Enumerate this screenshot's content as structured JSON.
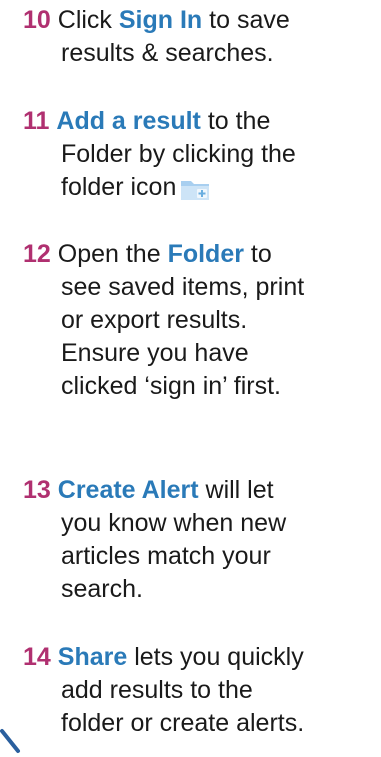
{
  "steps": [
    {
      "number": "10",
      "line1_pre": " Click ",
      "keyword": "Sign In",
      "line1_post": " to save",
      "line2": "results & searches."
    },
    {
      "number": "11",
      "keyword": "Add a result",
      "line1_post": " to the",
      "line2": "Folder by clicking the",
      "line3": "folder icon",
      "icon": "folder-add-icon"
    },
    {
      "number": "12",
      "line1_pre": " Open the ",
      "keyword": "Folder",
      "line1_post": " to",
      "line2": "see saved items, print",
      "line3": "or export results.",
      "line4": "Ensure you have",
      "line5": "clicked ‘sign in’ first."
    },
    {
      "number": "13",
      "keyword": "Create Alert",
      "line1_post": " will let",
      "line2": "you know when new",
      "line3": "articles match your",
      "line4": "search."
    },
    {
      "number": "14",
      "keyword": "Share",
      "line1_post": " lets you quickly",
      "line2": "add results to the",
      "line3": "folder or create alerts."
    }
  ],
  "colors": {
    "number": "#b03070",
    "keyword": "#2a7ab8",
    "text": "#1a1a1a",
    "folder_icon": "#9cc8ec"
  }
}
